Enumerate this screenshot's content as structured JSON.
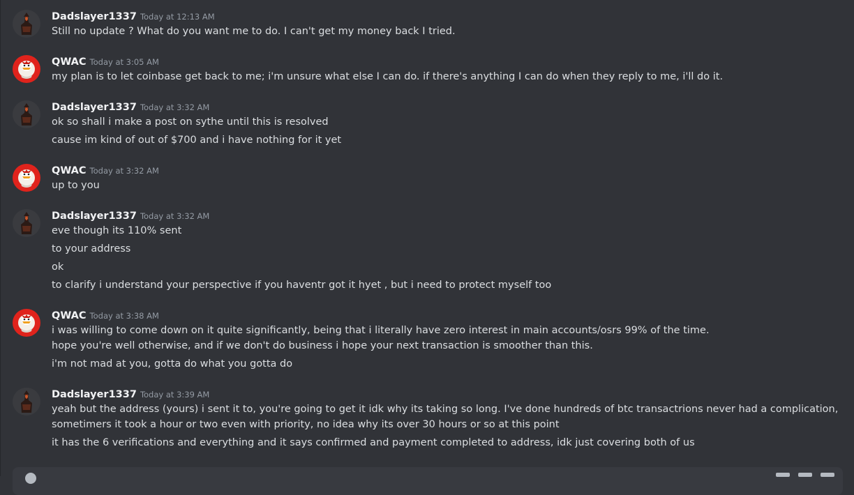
{
  "messages": [
    {
      "author": "Dadslayer1337",
      "avatar": "warrior-avatar",
      "timestamp": "Today at 12:13 AM",
      "lines": [
        "Still no update ? What do you want me to do. I can't get my money back I tried."
      ]
    },
    {
      "author": "QWAC",
      "avatar": "duck-avatar",
      "timestamp": "Today at 3:05 AM",
      "lines": [
        "my plan is to let coinbase get back to me; i'm unsure what else I can do. if there's anything I can do when they reply to me, i'll do it."
      ]
    },
    {
      "author": "Dadslayer1337",
      "avatar": "warrior-avatar",
      "timestamp": "Today at 3:32 AM",
      "lines": [
        "ok so shall i make a post on sythe until this is resolved",
        "cause im kind of out of $700 and i have nothing for it yet"
      ]
    },
    {
      "author": "QWAC",
      "avatar": "duck-avatar",
      "timestamp": "Today at 3:32 AM",
      "lines": [
        "up to you"
      ]
    },
    {
      "author": "Dadslayer1337",
      "avatar": "warrior-avatar",
      "timestamp": "Today at 3:32 AM",
      "lines": [
        "eve though its 110% sent",
        "to your address",
        "ok",
        "to clarify i understand your perspective if you haventr got it hyet , but i need to protect myself too"
      ]
    },
    {
      "author": "QWAC",
      "avatar": "duck-avatar",
      "timestamp": "Today at 3:38 AM",
      "lines": [
        "i was willing to come down on it quite significantly, being that i literally have zero interest in main accounts/osrs 99% of the time.",
        "hope you're well otherwise, and if we don't do business i hope your next transaction is smoother than this.",
        "i'm not mad at you, gotta do what you gotta do"
      ]
    },
    {
      "author": "Dadslayer1337",
      "avatar": "warrior-avatar",
      "timestamp": "Today at 3:39 AM",
      "lines": [
        "yeah but the address (yours) i sent it to, you're going to get it idk why its taking so long. I've done hundreds of btc transactrions never had a complication, sometimers it took a hour or two even with priority, no idea why its over 30 hours or so at this point",
        "it has the 6 verifications and everything and it says confirmed and payment completed to address, idk just covering both of us"
      ]
    }
  ]
}
